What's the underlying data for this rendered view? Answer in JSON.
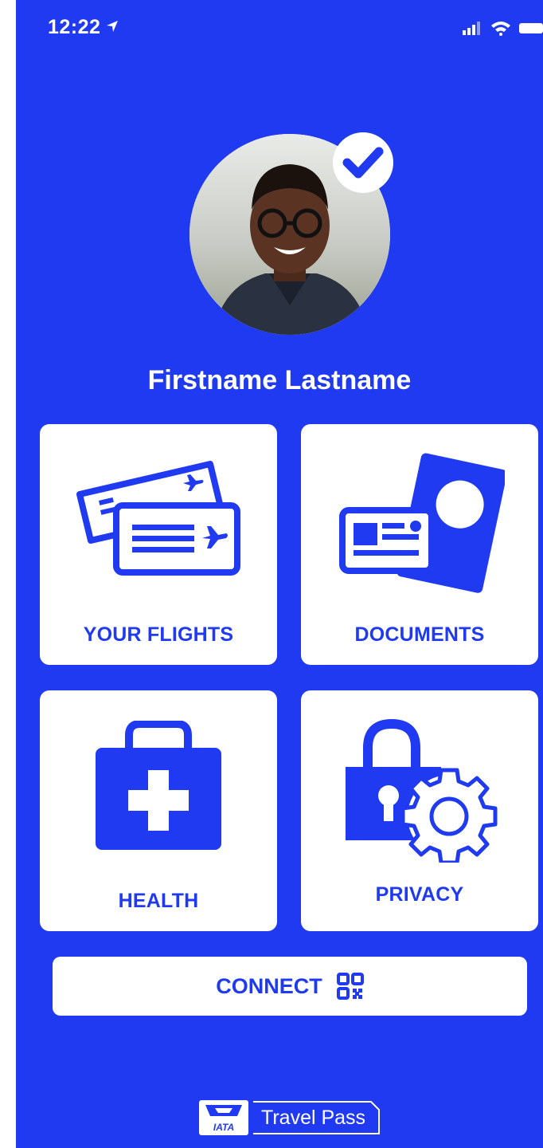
{
  "status_bar": {
    "time": "12:22",
    "location_icon": "location-arrow-icon",
    "signal_icon": "cellular-signal-icon",
    "wifi_icon": "wifi-icon",
    "battery_icon": "battery-icon"
  },
  "profile": {
    "name": "Firstname Lastname",
    "avatar_icon": "profile-photo",
    "verified_icon": "checkmark-icon"
  },
  "tiles": [
    {
      "label": "YOUR FLIGHTS",
      "icon": "boarding-pass-icon"
    },
    {
      "label": "DOCUMENTS",
      "icon": "passport-id-icon"
    },
    {
      "label": "HEALTH",
      "icon": "medical-kit-icon"
    },
    {
      "label": "PRIVACY",
      "icon": "lock-gear-icon"
    }
  ],
  "connect": {
    "label": "CONNECT",
    "icon": "qr-code-icon"
  },
  "brand": {
    "logo_text": "IATA",
    "name": "Travel Pass"
  },
  "colors": {
    "primary": "#1f3af0",
    "surface": "#ffffff"
  }
}
